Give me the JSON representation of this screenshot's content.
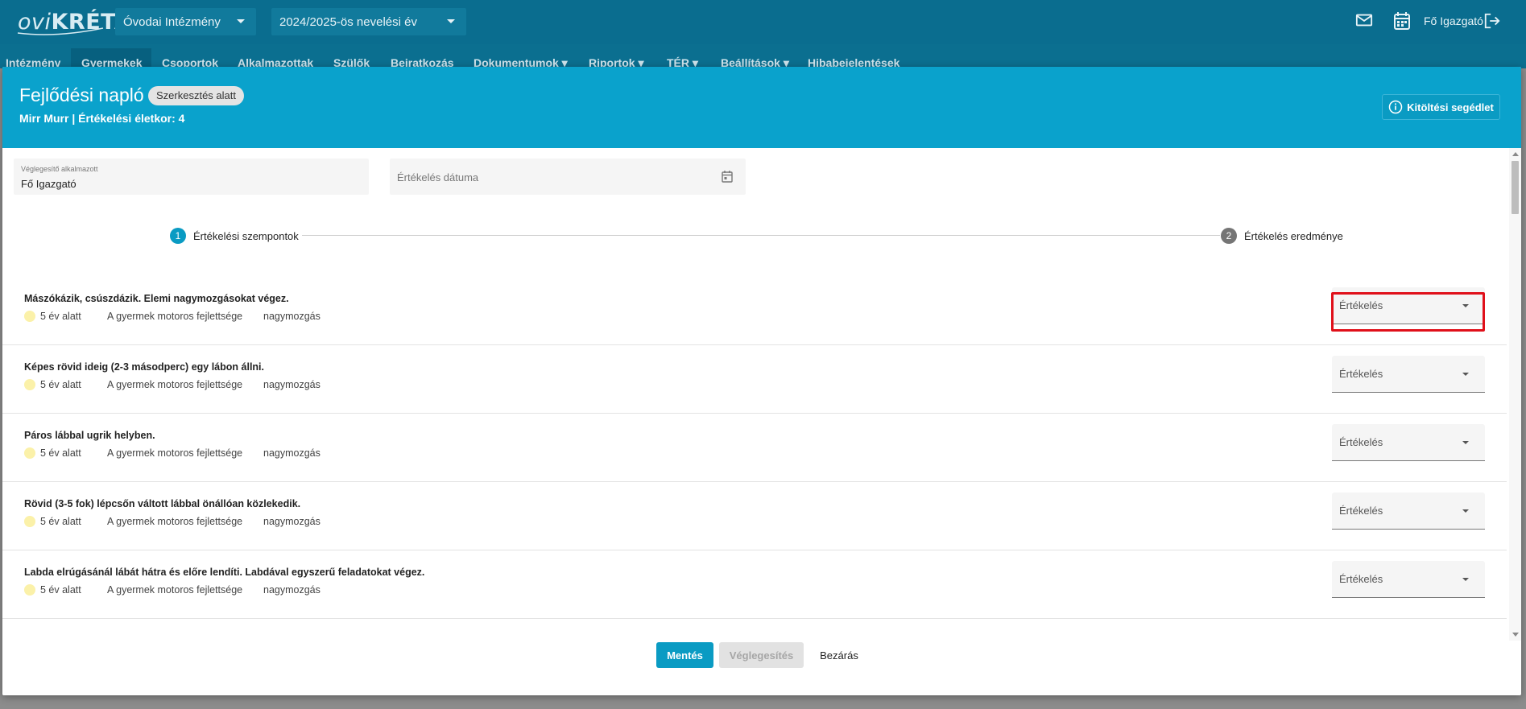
{
  "topbar": {
    "logo_prefix": "ovi",
    "logo_main": "KRÉTA",
    "institution_select": "Óvodai Intézmény",
    "year_select": "2024/2025-ös nevelési év",
    "user_name": "Fő Igazgató",
    "icons": [
      "mail-icon",
      "calendar-icon",
      "logout-icon"
    ]
  },
  "nav": {
    "items": [
      "Intézmény",
      "Gyermekek",
      "Csoportok",
      "Alkalmazottak",
      "Szülők",
      "Beiratkozás",
      "Dokumentumok ▾",
      "Riportok ▾",
      "TÉR ▾",
      "Beállítások ▾",
      "Hibabejelentések"
    ],
    "active": "Gyermekek"
  },
  "modal": {
    "title": "Fejlődési napló",
    "status_chip": "Szerkesztés alatt",
    "subtitle": "Mirr Murr   |   Értékelési életkor: 4",
    "help_button": "Kitöltési segédlet"
  },
  "form": {
    "finalizer_label": "Véglegesítő alkalmazott",
    "finalizer_value": "Fő Igazgató",
    "date_placeholder": "Értékelés dátuma"
  },
  "stepper": {
    "steps": [
      {
        "number": "1",
        "label": "Értékelési szempontok",
        "active": true
      },
      {
        "number": "2",
        "label": "Értékelés eredménye",
        "active": false
      }
    ]
  },
  "criteria": [
    {
      "title": "Mászókázik, csúszdázik. Elemi nagymozgásokat végez.",
      "age": "5 év alatt",
      "area": "A gyermek motoros fejlettsége",
      "sub": "nagymozgás",
      "eval": "Értékelés"
    },
    {
      "title": "Képes rövid ideig (2-3 másodperc) egy lábon állni.",
      "age": "5 év alatt",
      "area": "A gyermek motoros fejlettsége",
      "sub": "nagymozgás",
      "eval": "Értékelés"
    },
    {
      "title": "Páros lábbal ugrik helyben.",
      "age": "5 év alatt",
      "area": "A gyermek motoros fejlettsége",
      "sub": "nagymozgás",
      "eval": "Értékelés"
    },
    {
      "title": "Rövid (3-5 fok) lépcsőn váltott lábbal önállóan közlekedik.",
      "age": "5 év alatt",
      "area": "A gyermek motoros fejlettsége",
      "sub": "nagymozgás",
      "eval": "Értékelés"
    },
    {
      "title": "Labda elrúgásánál lábát hátra és előre lendíti. Labdával egyszerű feladatokat végez.",
      "age": "5 év alatt",
      "area": "A gyermek motoros fejlettsége",
      "sub": "nagymozgás",
      "eval": "Értékelés"
    }
  ],
  "footer": {
    "save": "Mentés",
    "finalize": "Véglegesítés",
    "close": "Bezárás"
  },
  "colors": {
    "topbar": "#0a6d8f",
    "header": "#0aa2cc",
    "primary": "#0a9bc3",
    "highlight": "#e0101a",
    "age_dot": "#fbf1a9"
  }
}
